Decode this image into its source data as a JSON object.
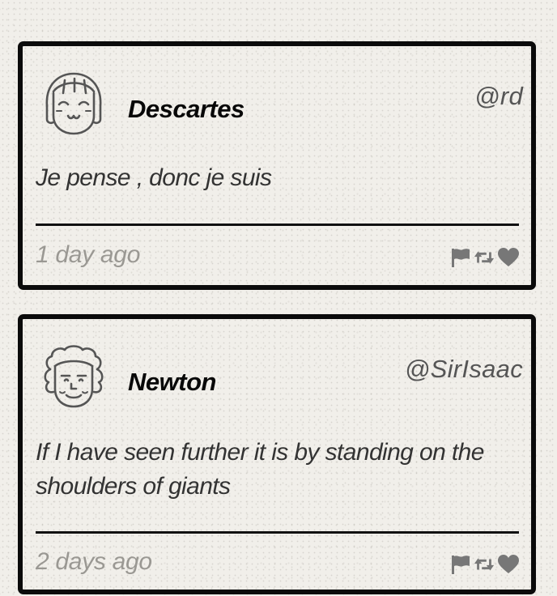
{
  "posts": [
    {
      "name": "Descartes",
      "handle": "@rd",
      "text": "Je pense , donc je suis",
      "time": "1 day ago",
      "avatar_icon": "girl-face-avatar"
    },
    {
      "name": "Newton",
      "handle": "@SirIsaac",
      "text": "If I have seen further it is by standing on the shoulders of giants",
      "time": "2 days ago",
      "avatar_icon": "curly-hair-face-avatar"
    }
  ],
  "action_icons": [
    "flag-icon",
    "retweet-icon",
    "heart-icon"
  ],
  "colors": {
    "background": "#f1efea",
    "border": "#0b0b0b",
    "name": "#080808",
    "handle": "#555555",
    "quote": "#333333",
    "timestamp": "#9a9893",
    "icons": "#777777"
  }
}
